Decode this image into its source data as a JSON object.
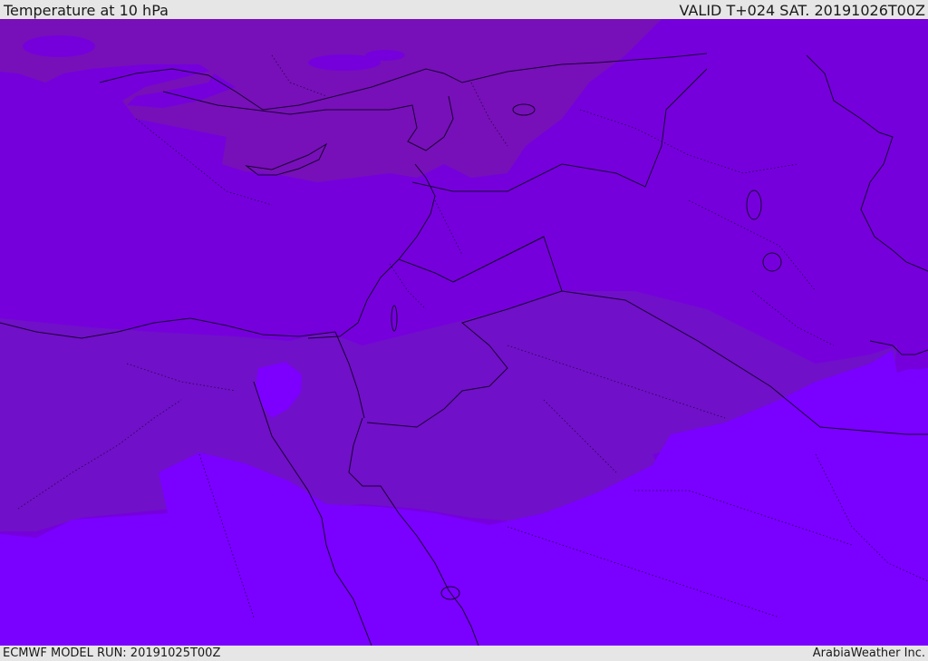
{
  "header": {
    "title": "Temperature at 10 hPa",
    "valid": "VALID T+024 SAT. 20191026T00Z"
  },
  "footer": {
    "model_run": "ECMWF MODEL RUN: 20191025T00Z",
    "credit": "ArabiaWeather Inc."
  },
  "map": {
    "parameter": "temperature",
    "level": "10 hPa",
    "colors": {
      "darkest_band": "#7710b8",
      "mid_band": "#7500dc",
      "light_band": "#7a00ff",
      "accent_patch": "#7d00ff",
      "coastline": "#1a0033"
    }
  }
}
